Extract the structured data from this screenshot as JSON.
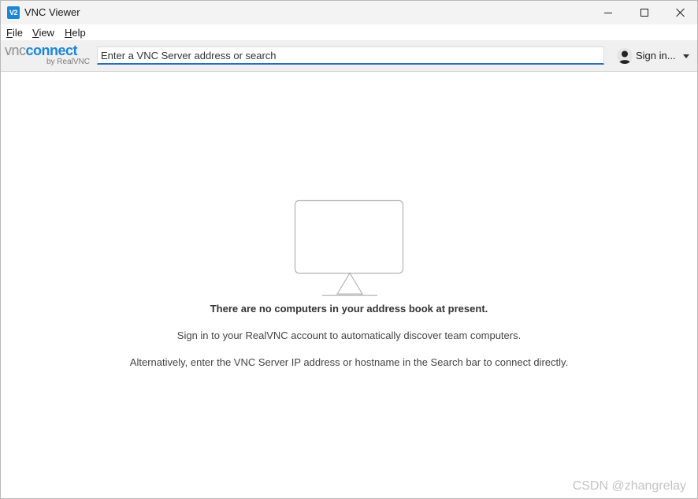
{
  "window": {
    "title": "VNC Viewer",
    "app_icon_text": "V2"
  },
  "menu": {
    "file": {
      "accel": "F",
      "rest": "ile"
    },
    "view": {
      "accel": "V",
      "rest": "iew"
    },
    "help": {
      "accel": "H",
      "rest": "elp"
    }
  },
  "toolbar": {
    "logo_vnc": "vnc",
    "logo_connect": "connect",
    "logo_by": "by RealVNC",
    "search_placeholder": "Enter a VNC Server address or search",
    "signin_label": "Sign in..."
  },
  "empty_state": {
    "title": "There are no computers in your address book at present.",
    "line1": "Sign in to your RealVNC account to automatically discover team computers.",
    "line2": "Alternatively, enter the VNC Server IP address or hostname in the Search bar to connect directly."
  },
  "watermark": "CSDN @zhangrelay",
  "colors": {
    "accent": "#1c87d9",
    "search_underline": "#2a6eb8",
    "icon_stroke": "#b3b3b3"
  }
}
